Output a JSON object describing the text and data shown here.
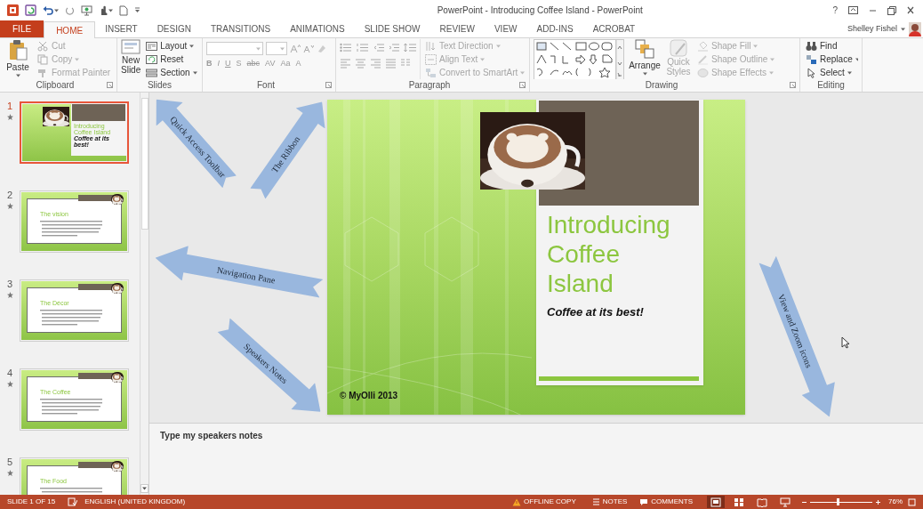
{
  "window": {
    "title": "PowerPoint - Introducing Coffee Island - PowerPoint",
    "help": "?",
    "user": "Shelley Fishel"
  },
  "tabs": [
    {
      "label": "FILE",
      "kind": "file",
      "selected": false
    },
    {
      "label": "HOME",
      "kind": "tab",
      "selected": true
    },
    {
      "label": "INSERT",
      "kind": "tab",
      "selected": false
    },
    {
      "label": "DESIGN",
      "kind": "tab",
      "selected": false
    },
    {
      "label": "TRANSITIONS",
      "kind": "tab",
      "selected": false
    },
    {
      "label": "ANIMATIONS",
      "kind": "tab",
      "selected": false
    },
    {
      "label": "SLIDE SHOW",
      "kind": "tab",
      "selected": false
    },
    {
      "label": "REVIEW",
      "kind": "tab",
      "selected": false
    },
    {
      "label": "VIEW",
      "kind": "tab",
      "selected": false
    },
    {
      "label": "ADD-INS",
      "kind": "tab",
      "selected": false
    },
    {
      "label": "ACROBAT",
      "kind": "tab",
      "selected": false
    }
  ],
  "ribbon": {
    "groups": [
      {
        "kind": "clipboard",
        "label": "Clipboard",
        "items": [
          {
            "label": "Paste",
            "disabled": false
          },
          {
            "label": "Cut",
            "disabled": true
          },
          {
            "label": "Copy",
            "disabled": true
          },
          {
            "label": "Format Painter",
            "disabled": true
          }
        ]
      },
      {
        "kind": "slides",
        "label": "Slides",
        "items": [
          {
            "label": "New Slide",
            "disabled": false
          },
          {
            "label": "Layout",
            "disabled": false
          },
          {
            "label": "Reset",
            "disabled": false
          },
          {
            "label": "Section",
            "disabled": false
          }
        ]
      },
      {
        "kind": "font",
        "label": "Font",
        "items": [
          {
            "label": "B",
            "disabled": true
          },
          {
            "label": "I",
            "disabled": true
          },
          {
            "label": "U",
            "disabled": true
          },
          {
            "label": "S",
            "disabled": true
          },
          {
            "label": "abc",
            "disabled": true
          },
          {
            "label": "AV",
            "disabled": true
          },
          {
            "label": "Aa",
            "disabled": true
          },
          {
            "label": "A",
            "disabled": true
          }
        ]
      },
      {
        "kind": "paragraph",
        "label": "Paragraph",
        "items": [
          {
            "label": "Text Direction",
            "disabled": true
          },
          {
            "label": "Align Text",
            "disabled": true
          },
          {
            "label": "Convert to SmartArt",
            "disabled": true
          }
        ]
      },
      {
        "kind": "drawing",
        "label": "Drawing",
        "items": [
          {
            "label": "Arrange",
            "disabled": false
          },
          {
            "label": "Quick Styles",
            "disabled": true
          },
          {
            "label": "Shape Fill",
            "disabled": true
          },
          {
            "label": "Shape Outline",
            "disabled": true
          },
          {
            "label": "Shape Effects",
            "disabled": true
          }
        ]
      },
      {
        "kind": "editing",
        "label": "Editing",
        "items": [
          {
            "label": "Find",
            "disabled": false
          },
          {
            "label": "Replace",
            "disabled": false
          },
          {
            "label": "Select",
            "disabled": false
          }
        ]
      }
    ]
  },
  "slides": [
    {
      "number": "1",
      "kind": "title",
      "title": "Introducing Coffee Island",
      "subtitle": "Coffee at its best!",
      "selected": true
    },
    {
      "number": "2",
      "kind": "content",
      "title": "The vision",
      "selected": false
    },
    {
      "number": "3",
      "kind": "content",
      "title": "The Décor",
      "selected": false
    },
    {
      "number": "4",
      "kind": "content",
      "title": "The Coffee",
      "selected": false
    },
    {
      "number": "5",
      "kind": "content",
      "title": "The Food",
      "selected": false
    }
  ],
  "slide": {
    "title": "Introducing Coffee Island",
    "subtitle": "Coffee at its best!",
    "footer": "© MyOlli 2013"
  },
  "notes": "Type my speakers notes",
  "status_bar": {
    "slide": "SLIDE 1 OF 15",
    "language": "ENGLISH (UNITED KINGDOM)",
    "offline": "OFFLINE COPY",
    "notes": "NOTES",
    "comments": "COMMENTS",
    "views": [
      {
        "kind": "normal",
        "selected": true
      },
      {
        "kind": "sorter",
        "selected": false
      },
      {
        "kind": "reading",
        "selected": false
      },
      {
        "kind": "slideshow",
        "selected": false
      }
    ],
    "zoom": {
      "level": 0.45,
      "reading": "76%"
    }
  },
  "callouts": [
    {
      "label": "Quick Access Toolbar"
    },
    {
      "label": "The Ribbon"
    },
    {
      "label": "Navigation Pane"
    },
    {
      "label": "Speakers Notes"
    },
    {
      "label": "View and Zoom icons"
    }
  ]
}
